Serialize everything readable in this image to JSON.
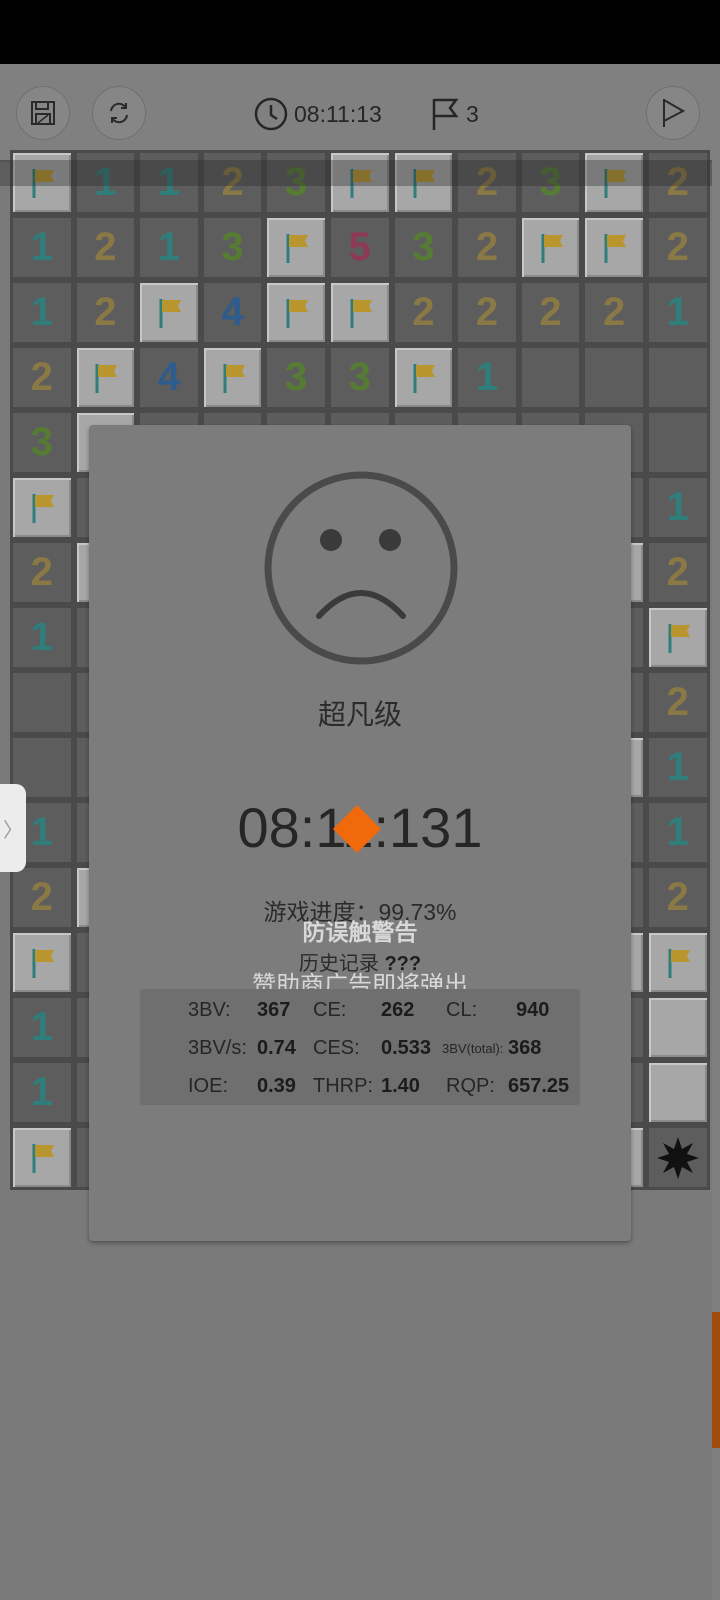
{
  "toolbar": {
    "save_icon": "save-icon",
    "restart_icon": "restart-icon",
    "timer": "08:11:13",
    "flag_count": "3",
    "play_icon": "play-icon"
  },
  "board": {
    "rows": [
      [
        "F",
        "1",
        "1",
        "2",
        "3",
        "F",
        "F",
        "2",
        "3",
        "F",
        "2"
      ],
      [
        "1",
        "2",
        "1",
        "3",
        "F",
        "5",
        "3",
        "2",
        "F",
        "F",
        "2"
      ],
      [
        "1",
        "2",
        "F",
        "4",
        "F",
        "F",
        "2",
        "2",
        "2",
        "2",
        "1"
      ],
      [
        "2",
        "F",
        "4",
        "F",
        "3",
        "3",
        "F",
        "1",
        "",
        "",
        ""
      ],
      [
        "3",
        "F",
        "",
        "",
        "",
        "",
        "",
        "",
        "",
        "",
        ""
      ],
      [
        "F",
        "",
        "",
        "",
        "",
        "",
        "",
        "",
        "",
        "",
        "1"
      ],
      [
        "2",
        "C",
        "",
        "",
        "",
        "",
        "",
        "",
        "",
        "C",
        "2"
      ],
      [
        "1",
        "",
        "",
        "",
        "",
        "",
        "",
        "",
        "",
        "",
        "F"
      ],
      [
        "",
        "",
        "",
        "",
        "",
        "",
        "",
        "",
        "",
        "",
        "2"
      ],
      [
        "",
        "",
        "",
        "",
        "",
        "",
        "",
        "",
        "",
        "C",
        "1"
      ],
      [
        "1",
        "",
        "",
        "",
        "",
        "",
        "",
        "",
        "",
        "",
        "1"
      ],
      [
        "2",
        "C",
        "",
        "",
        "",
        "",
        "",
        "",
        "",
        "",
        "2"
      ],
      [
        "F",
        "",
        "",
        "",
        "",
        "",
        "",
        "",
        "",
        "C",
        "F"
      ],
      [
        "1",
        "",
        "",
        "",
        "",
        "",
        "",
        "",
        "",
        "",
        "C"
      ],
      [
        "1",
        "",
        "",
        "",
        "",
        "",
        "",
        "",
        "",
        "",
        "C"
      ],
      [
        "F",
        "",
        "",
        "",
        "",
        "",
        "",
        "",
        "",
        "C",
        "M"
      ]
    ]
  },
  "dialog": {
    "level": "超凡级",
    "time": "08:11:131",
    "progress": "游戏进度：99.73%",
    "warning": "防误触警告",
    "history_label": "历史记录",
    "history_value": "???",
    "ad_note": "赞助商广告即将弹出",
    "stats": {
      "bv_label": "3BV:",
      "bv": "367",
      "ce_label": "CE:",
      "ce": "262",
      "cl_label": "CL:",
      "cl": "940",
      "bvs_label": "3BV/s:",
      "bvs": "0.74",
      "ces_label": "CES:",
      "ces": "0.533",
      "bvt_label": "3BV(total):",
      "bvt": "368",
      "ioe_label": "IOE:",
      "ioe": "0.39",
      "thrp_label": "THRP:",
      "thrp": "1.40",
      "rqp_label": "RQP:",
      "rqp": "657.25"
    }
  },
  "colors": {
    "accent_orange": "#f06a0c",
    "flag_yellow": "#b9952d",
    "flag_pole": "#2f7e7c"
  }
}
